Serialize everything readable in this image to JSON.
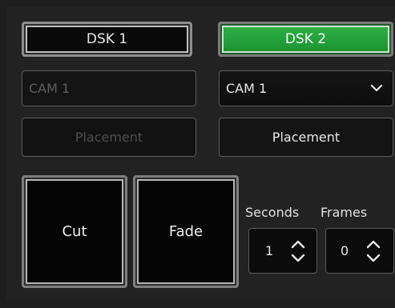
{
  "dsk": {
    "dsk1_label": "DSK 1",
    "dsk2_label": "DSK 2",
    "active_color": "#2aa843"
  },
  "camera": {
    "left_value": "CAM 1",
    "right_value": "CAM 1"
  },
  "placement": {
    "left_label": "Placement",
    "right_label": "Placement"
  },
  "transition": {
    "cut_label": "Cut",
    "fade_label": "Fade",
    "seconds_label": "Seconds",
    "frames_label": "Frames",
    "seconds_value": "1",
    "frames_value": "0"
  }
}
